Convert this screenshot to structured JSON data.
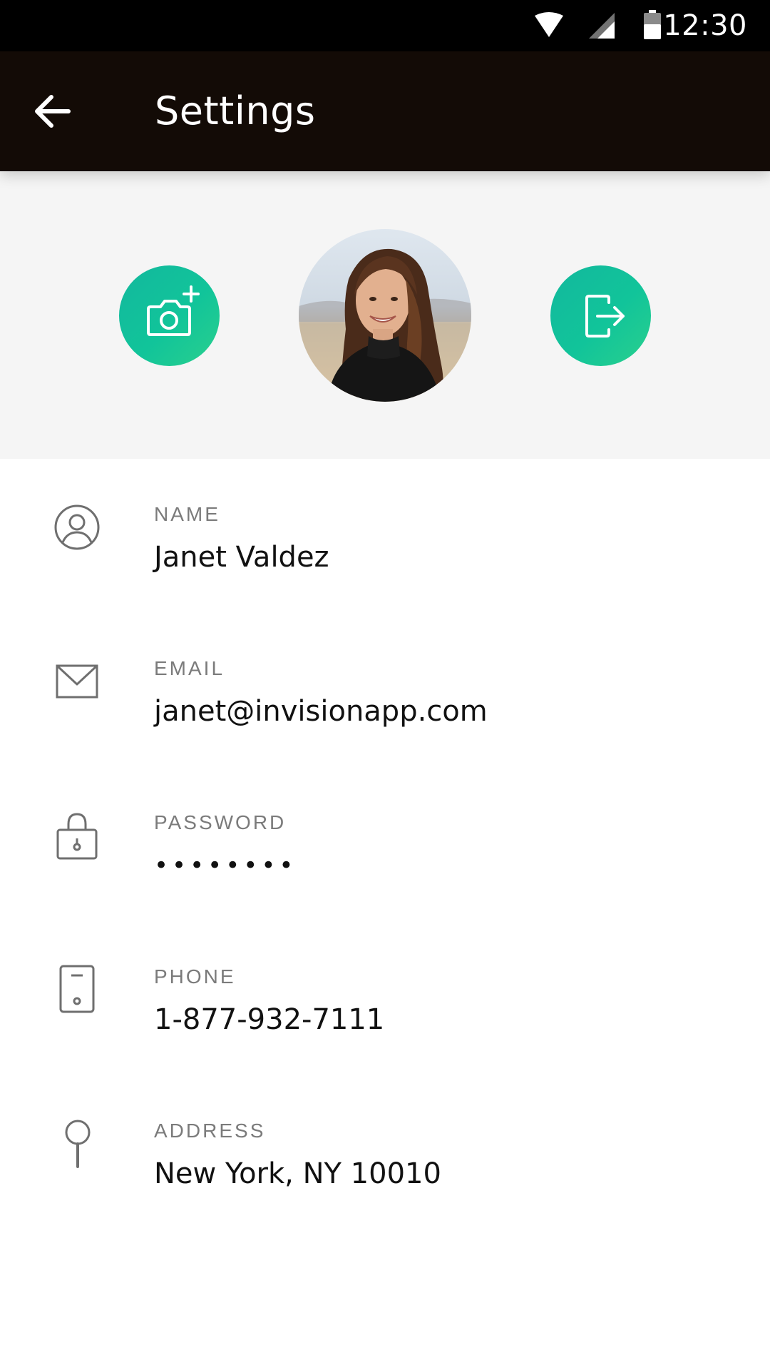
{
  "status_bar": {
    "time": "12:30",
    "icons": [
      "wifi-icon",
      "signal-icon",
      "battery-icon"
    ]
  },
  "toolbar": {
    "title": "Settings",
    "back_icon": "arrow-left-icon"
  },
  "profile": {
    "camera_icon": "camera-add-icon",
    "logout_icon": "logout-icon",
    "accent_color": "#13b89d"
  },
  "fields": [
    {
      "label": "NAME",
      "value": "Janet Valdez",
      "icon": "user-icon"
    },
    {
      "label": "EMAIL",
      "value": "janet@invisionapp.com",
      "icon": "mail-icon"
    },
    {
      "label": "PASSWORD",
      "value": "••••••••",
      "icon": "lock-icon"
    },
    {
      "label": "PHONE",
      "value": "1-877-932-7111",
      "icon": "phone-icon"
    },
    {
      "label": "ADDRESS",
      "value": "New York, NY 10010",
      "icon": "pin-icon"
    }
  ]
}
